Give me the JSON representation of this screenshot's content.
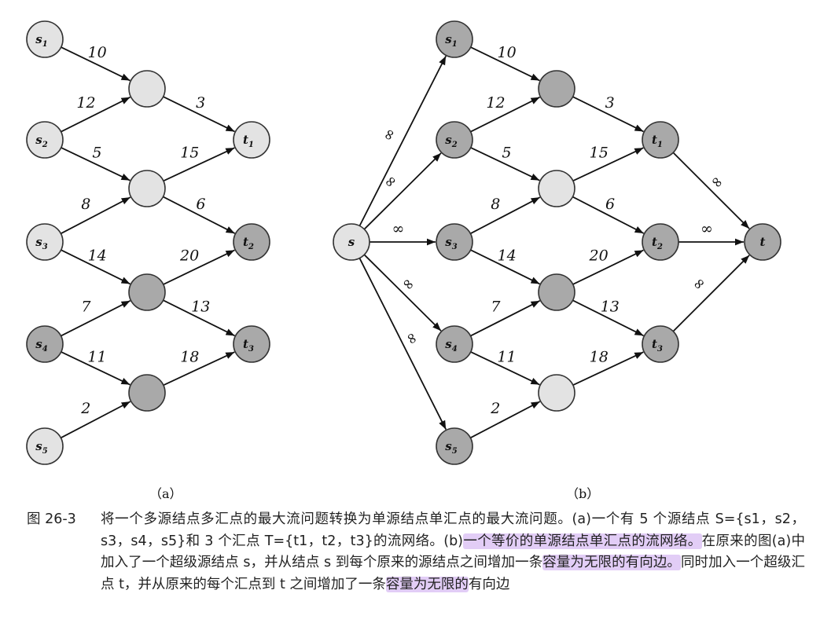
{
  "figure": {
    "subfigure_labels": [
      "（a）",
      "（b）"
    ],
    "diagram_a": {
      "nodes": [
        {
          "id": "s1",
          "label": "s",
          "sub": "1",
          "shade": "light"
        },
        {
          "id": "s2",
          "label": "s",
          "sub": "2",
          "shade": "light"
        },
        {
          "id": "s3",
          "label": "s",
          "sub": "3",
          "shade": "light"
        },
        {
          "id": "s4",
          "label": "s",
          "sub": "4",
          "shade": "dark"
        },
        {
          "id": "s5",
          "label": "s",
          "sub": "5",
          "shade": "light"
        },
        {
          "id": "m1",
          "label": "",
          "sub": "",
          "shade": "light"
        },
        {
          "id": "m2",
          "label": "",
          "sub": "",
          "shade": "light"
        },
        {
          "id": "m3",
          "label": "",
          "sub": "",
          "shade": "dark"
        },
        {
          "id": "m4",
          "label": "",
          "sub": "",
          "shade": "dark"
        },
        {
          "id": "t1",
          "label": "t",
          "sub": "1",
          "shade": "light"
        },
        {
          "id": "t2",
          "label": "t",
          "sub": "2",
          "shade": "dark"
        },
        {
          "id": "t3",
          "label": "t",
          "sub": "3",
          "shade": "dark"
        }
      ],
      "edges": [
        {
          "from": "s1",
          "to": "m1",
          "capacity": "10"
        },
        {
          "from": "s2",
          "to": "m1",
          "capacity": "12"
        },
        {
          "from": "s2",
          "to": "m2",
          "capacity": "5"
        },
        {
          "from": "s3",
          "to": "m2",
          "capacity": "8"
        },
        {
          "from": "s3",
          "to": "m3",
          "capacity": "14"
        },
        {
          "from": "s4",
          "to": "m3",
          "capacity": "7"
        },
        {
          "from": "s4",
          "to": "m4",
          "capacity": "11"
        },
        {
          "from": "s5",
          "to": "m4",
          "capacity": "2"
        },
        {
          "from": "m1",
          "to": "t1",
          "capacity": "3"
        },
        {
          "from": "m2",
          "to": "t1",
          "capacity": "15"
        },
        {
          "from": "m2",
          "to": "t2",
          "capacity": "6"
        },
        {
          "from": "m3",
          "to": "t2",
          "capacity": "20"
        },
        {
          "from": "m3",
          "to": "t3",
          "capacity": "13"
        },
        {
          "from": "m4",
          "to": "t3",
          "capacity": "18"
        }
      ]
    },
    "diagram_b": {
      "nodes": [
        {
          "id": "s",
          "label": "s",
          "sub": "",
          "shade": "light"
        },
        {
          "id": "s1",
          "label": "s",
          "sub": "1",
          "shade": "dark"
        },
        {
          "id": "s2",
          "label": "s",
          "sub": "2",
          "shade": "dark"
        },
        {
          "id": "s3",
          "label": "s",
          "sub": "3",
          "shade": "dark"
        },
        {
          "id": "s4",
          "label": "s",
          "sub": "4",
          "shade": "dark"
        },
        {
          "id": "s5",
          "label": "s",
          "sub": "5",
          "shade": "dark"
        },
        {
          "id": "m1",
          "label": "",
          "sub": "",
          "shade": "dark"
        },
        {
          "id": "m2",
          "label": "",
          "sub": "",
          "shade": "light"
        },
        {
          "id": "m3",
          "label": "",
          "sub": "",
          "shade": "dark"
        },
        {
          "id": "m4",
          "label": "",
          "sub": "",
          "shade": "light"
        },
        {
          "id": "t1",
          "label": "t",
          "sub": "1",
          "shade": "dark"
        },
        {
          "id": "t2",
          "label": "t",
          "sub": "2",
          "shade": "dark"
        },
        {
          "id": "t3",
          "label": "t",
          "sub": "3",
          "shade": "dark"
        },
        {
          "id": "t",
          "label": "t",
          "sub": "",
          "shade": "dark"
        }
      ],
      "edges": [
        {
          "from": "s",
          "to": "s1",
          "capacity": "∞"
        },
        {
          "from": "s",
          "to": "s2",
          "capacity": "∞"
        },
        {
          "from": "s",
          "to": "s3",
          "capacity": "∞"
        },
        {
          "from": "s",
          "to": "s4",
          "capacity": "∞"
        },
        {
          "from": "s",
          "to": "s5",
          "capacity": "∞"
        },
        {
          "from": "s1",
          "to": "m1",
          "capacity": "10"
        },
        {
          "from": "s2",
          "to": "m1",
          "capacity": "12"
        },
        {
          "from": "s2",
          "to": "m2",
          "capacity": "5"
        },
        {
          "from": "s3",
          "to": "m2",
          "capacity": "8"
        },
        {
          "from": "s3",
          "to": "m3",
          "capacity": "14"
        },
        {
          "from": "s4",
          "to": "m3",
          "capacity": "7"
        },
        {
          "from": "s4",
          "to": "m4",
          "capacity": "11"
        },
        {
          "from": "s5",
          "to": "m4",
          "capacity": "2"
        },
        {
          "from": "m1",
          "to": "t1",
          "capacity": "3"
        },
        {
          "from": "m2",
          "to": "t1",
          "capacity": "15"
        },
        {
          "from": "m2",
          "to": "t2",
          "capacity": "6"
        },
        {
          "from": "m3",
          "to": "t2",
          "capacity": "20"
        },
        {
          "from": "m3",
          "to": "t3",
          "capacity": "13"
        },
        {
          "from": "m4",
          "to": "t3",
          "capacity": "18"
        },
        {
          "from": "t1",
          "to": "t",
          "capacity": "∞"
        },
        {
          "from": "t2",
          "to": "t",
          "capacity": "∞"
        },
        {
          "from": "t3",
          "to": "t",
          "capacity": "∞"
        }
      ]
    }
  },
  "caption": {
    "label": "图 26-3",
    "part1": "将一个多源结点多汇点的最大流问题转换为单源结点单汇点的最大流问题。(a)一个有 5 个源结点 S={s1，s2，s3，s4，s5}和 3 个汇点 T={t1，t2，t3}的流网络。(b)",
    "highlight1": "一个等价的单源结点单汇点的流网络。",
    "part2": "在原来的图(a)中加入了一个超级源结点 s，并从结点 s 到每个原来的源结点之间增加一条",
    "highlight2": "容量为无限的有向边。",
    "part3": "同时加入一个超级汇点 t，并从原来的每个汇点到 t 之间增加了一条",
    "highlight3": "容量为无限的",
    "part4": "有向边"
  },
  "colors": {
    "node_light": "#e3e3e3",
    "node_dark": "#a9a9a9",
    "highlight": "#e2cdf6"
  }
}
